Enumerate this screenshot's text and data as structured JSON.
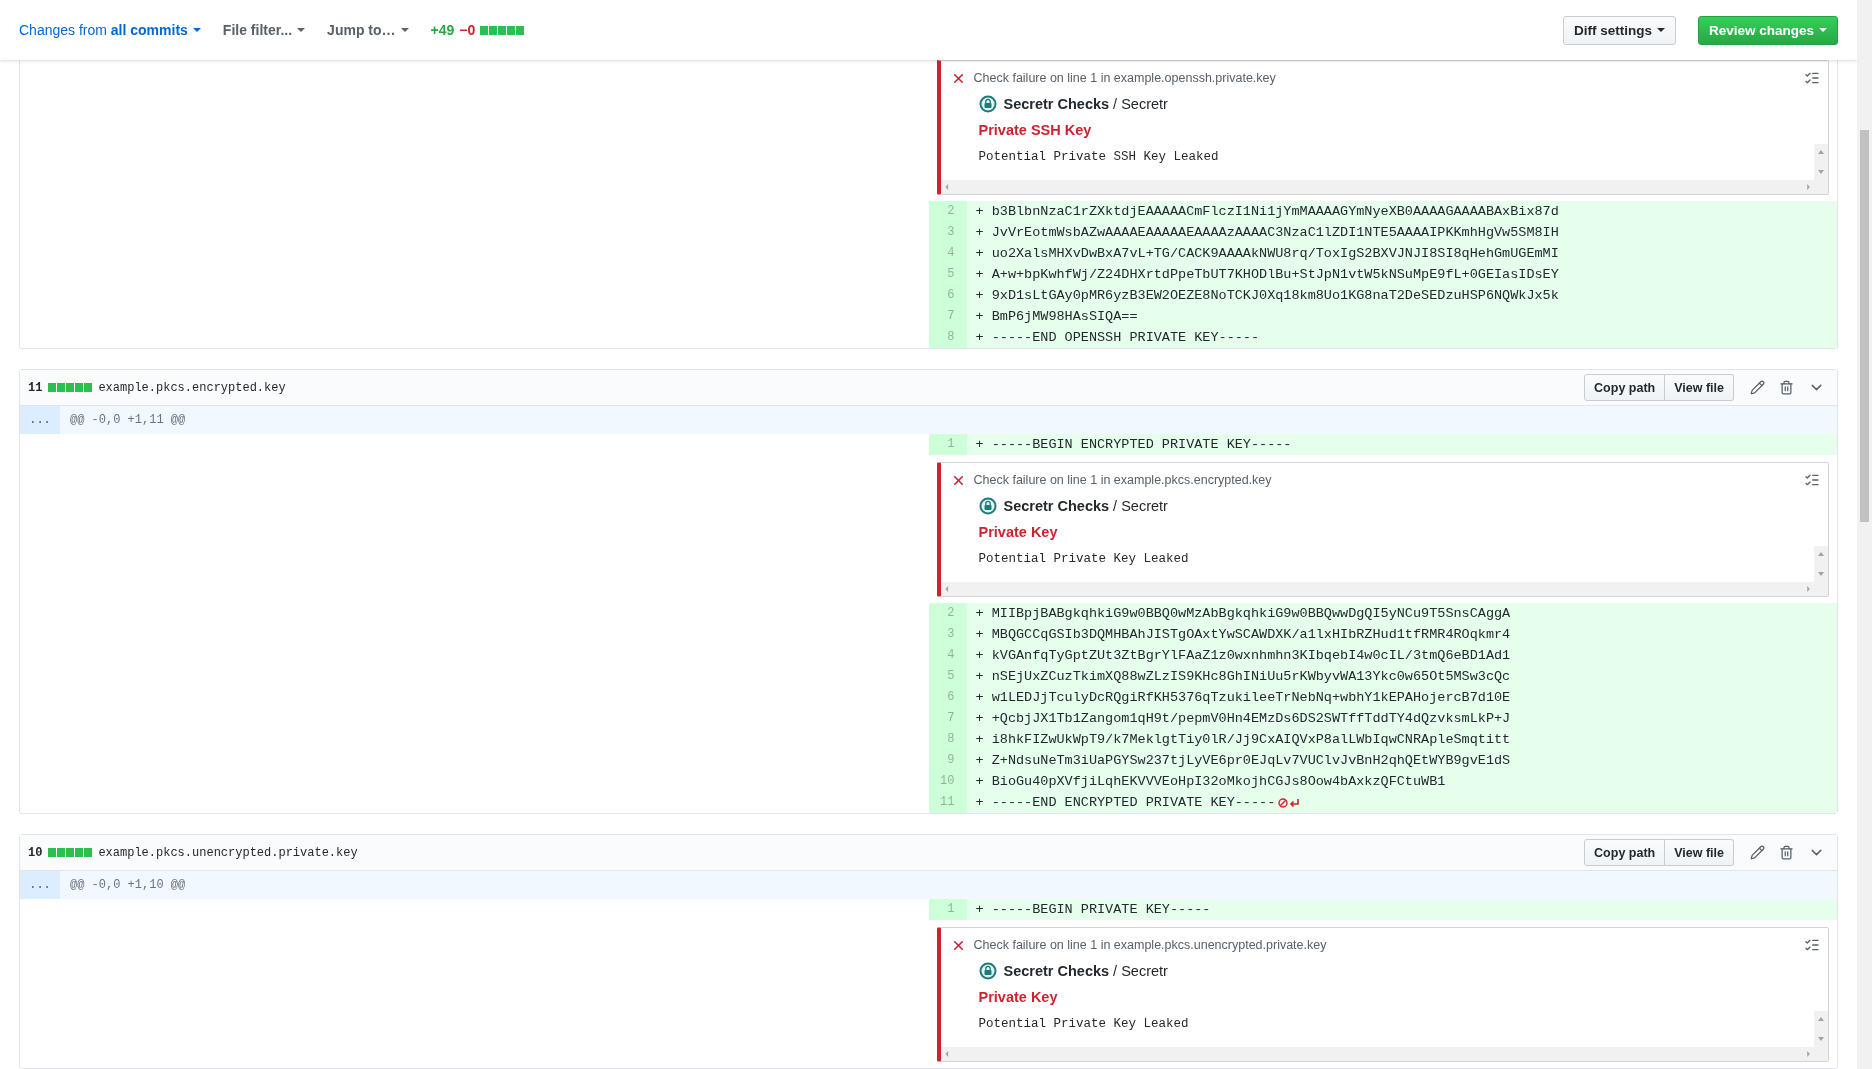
{
  "toolbar": {
    "changes_label": "Changes from",
    "changes_value": "all commits",
    "file_filter": "File filter...",
    "jump_to": "Jump to…",
    "additions": "+49",
    "deletions": "−0",
    "diff_settings": "Diff settings",
    "review_changes": "Review changes"
  },
  "files": [
    {
      "rows": [
        {
          "kind": "annotation",
          "title": "Check failure on line 1 in example.openssh.private.key",
          "app": "Secretr Checks",
          "source": "/ Secretr",
          "heading": "Private SSH Key",
          "message": "Potential Private SSH Key Leaked"
        },
        {
          "kind": "line",
          "number": "2",
          "text": "+ b3BlbnNzaC1rZXktdjEAAAAACmFlczI1Ni1jYmMAAAAGYmNyeXB0AAAAGAAAABAxBix87d",
          "no_newline": false
        },
        {
          "kind": "line",
          "number": "3",
          "text": "+ JvVrEotmWsbAZwAAAAEAAAAAEAAAAzAAAAC3NzaC1lZDI1NTE5AAAAIPKKmhHgVw5SM8IH",
          "no_newline": false
        },
        {
          "kind": "line",
          "number": "4",
          "text": "+ uo2XalsMHXvDwBxA7vL+TG/CACK9AAAAkNWU8rq/ToxIgS2BXVJNJI8SI8qHehGmUGEmMI",
          "no_newline": false
        },
        {
          "kind": "line",
          "number": "5",
          "text": "+ A+w+bpKwhfWj/Z24DHXrtdPpeTbUT7KHODlBu+StJpN1vtW5kNSuMpE9fL+0GEIasIDsEY",
          "no_newline": false
        },
        {
          "kind": "line",
          "number": "6",
          "text": "+ 9xD1sLtGAy0pMR6yzB3EW2OEZE8NoTCKJ0Xq18km8Uo1KG8naT2DeSEDzuHSP6NQWkJx5k",
          "no_newline": false
        },
        {
          "kind": "line",
          "number": "7",
          "text": "+ BmP6jMW98HAsSIQA==",
          "no_newline": false
        },
        {
          "kind": "line",
          "number": "8",
          "text": "+ -----END OPENSSH PRIVATE KEY-----",
          "no_newline": false
        }
      ]
    },
    {
      "header": {
        "count": "11",
        "name": "example.pkcs.encrypted.key",
        "copy_path": "Copy path",
        "view_file": "View file"
      },
      "hunk": {
        "expander": "...",
        "text": "@@ -0,0 +1,11 @@"
      },
      "rows": [
        {
          "kind": "line",
          "number": "1",
          "text": "+ -----BEGIN ENCRYPTED PRIVATE KEY-----",
          "no_newline": false
        },
        {
          "kind": "annotation",
          "title": "Check failure on line 1 in example.pkcs.encrypted.key",
          "app": "Secretr Checks",
          "source": "/ Secretr",
          "heading": "Private Key",
          "message": "Potential Private Key Leaked"
        },
        {
          "kind": "line",
          "number": "2",
          "text": "+ MIIBpjBABgkqhkiG9w0BBQ0wMzAbBgkqhkiG9w0BBQwwDgQI5yNCu9T5SnsCAggA",
          "no_newline": false
        },
        {
          "kind": "line",
          "number": "3",
          "text": "+ MBQGCCqGSIb3DQMHBAhJISTgOAxtYwSCAWDXK/a1lxHIbRZHud1tfRMR4ROqkmr4",
          "no_newline": false
        },
        {
          "kind": "line",
          "number": "4",
          "text": "+ kVGAnfqTyGptZUt3ZtBgrYlFAaZ1z0wxnhmhn3KIbqebI4w0cIL/3tmQ6eBD1Ad1",
          "no_newline": false
        },
        {
          "kind": "line",
          "number": "5",
          "text": "+ nSEjUxZCuzTkimXQ88wZLzIS9KHc8GhINiUu5rKWbyvWA13Ykc0w65Ot5MSw3cQc",
          "no_newline": false
        },
        {
          "kind": "line",
          "number": "6",
          "text": "+ w1LEDJjTculyDcRQgiRfKH5376qTzukileeTrNebNq+wbhY1kEPAHojercB7d10E",
          "no_newline": false
        },
        {
          "kind": "line",
          "number": "7",
          "text": "+ +QcbjJX1Tb1Zangom1qH9t/pepmV0Hn4EMzDs6DS2SWTffTddTY4dQzvksmLkP+J",
          "no_newline": false
        },
        {
          "kind": "line",
          "number": "8",
          "text": "+ i8hkFIZwUkWpT9/k7MeklgtTiy0lR/Jj9CxAIQVxP8alLWbIqwCNRApleSmqtitt",
          "no_newline": false
        },
        {
          "kind": "line",
          "number": "9",
          "text": "+ Z+NdsuNeTm3iUaPGYSw237tjLyVE6pr0EJqLv7VUClvJvBnH2qhQEtWYB9gvE1dS",
          "no_newline": false
        },
        {
          "kind": "line",
          "number": "10",
          "text": "+ BioGu40pXVfjiLqhEKVVVEoHpI32oMkojhCGJs8Oow4bAxkzQFCtuWB1",
          "no_newline": false
        },
        {
          "kind": "line",
          "number": "11",
          "text": "+ -----END ENCRYPTED PRIVATE KEY-----",
          "no_newline": true
        }
      ]
    },
    {
      "header": {
        "count": "10",
        "name": "example.pkcs.unencrypted.private.key",
        "copy_path": "Copy path",
        "view_file": "View file"
      },
      "hunk": {
        "expander": "...",
        "text": "@@ -0,0 +1,10 @@"
      },
      "rows": [
        {
          "kind": "line",
          "number": "1",
          "text": "+ -----BEGIN PRIVATE KEY-----",
          "no_newline": false
        },
        {
          "kind": "annotation",
          "title": "Check failure on line 1 in example.pkcs.unencrypted.private.key",
          "app": "Secretr Checks",
          "source": "/ Secretr",
          "heading": "Private Key",
          "message": "Potential Private Key Leaked"
        }
      ]
    }
  ]
}
